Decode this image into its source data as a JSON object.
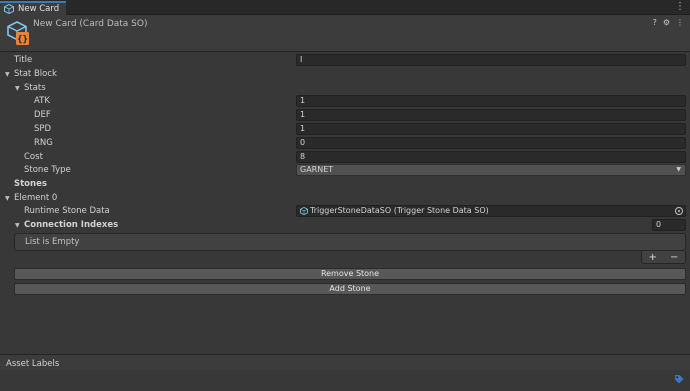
{
  "window": {
    "tab_title": "New Card"
  },
  "header": {
    "asset_title": "New Card (Card Data SO)",
    "help": "?",
    "settings": "⚙"
  },
  "fields": {
    "title": {
      "label": "Title",
      "value": "I"
    },
    "stat_block": {
      "label": "Stat Block"
    },
    "stats": {
      "label": "Stats"
    },
    "atk": {
      "label": "ATK",
      "value": "1"
    },
    "def": {
      "label": "DEF",
      "value": "1"
    },
    "spd": {
      "label": "SPD",
      "value": "1"
    },
    "rng": {
      "label": "RNG",
      "value": "0"
    },
    "cost": {
      "label": "Cost",
      "value": "8"
    },
    "stone_type": {
      "label": "Stone Type",
      "value": "GARNET"
    },
    "stones": {
      "label": "Stones"
    },
    "element0": {
      "label": "Element 0"
    },
    "runtime_stone_data": {
      "label": "Runtime Stone Data",
      "value": "TriggerStoneDataSO (Trigger Stone Data SO)"
    },
    "connection_indexes": {
      "label": "Connection Indexes",
      "size": "0",
      "empty_text": "List is Empty"
    }
  },
  "list_controls": {
    "add": "+",
    "remove": "−"
  },
  "buttons": {
    "remove_stone": "Remove Stone",
    "add_stone": "Add Stone"
  },
  "footer": {
    "asset_labels": "Asset Labels"
  },
  "icons": {
    "tab": "scriptable-object-icon",
    "asset": "scriptable-object-icon",
    "object_field": "scriptable-object-icon",
    "labels": "tag-icon"
  },
  "colors": {
    "accent": "#3a79bb",
    "icon_orange": "#e9823a",
    "icon_blue": "#7ec6e9"
  }
}
